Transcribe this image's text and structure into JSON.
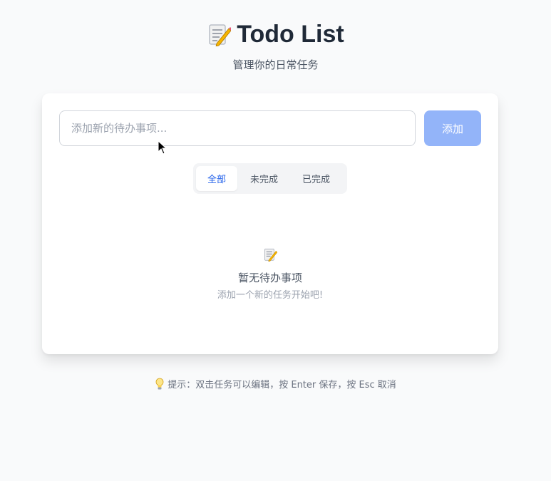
{
  "header": {
    "title": "Todo List",
    "title_icon": "memo-pencil-icon",
    "subtitle": "管理你的日常任务"
  },
  "composer": {
    "input_value": "",
    "input_placeholder": "添加新的待办事项...",
    "add_label": "添加"
  },
  "filters": {
    "tabs": [
      {
        "label": "全部",
        "active": true
      },
      {
        "label": "未完成",
        "active": false
      },
      {
        "label": "已完成",
        "active": false
      }
    ]
  },
  "empty_state": {
    "icon": "memo-pencil-icon",
    "title": "暂无待办事项",
    "subtitle": "添加一个新的任务开始吧!"
  },
  "hint": {
    "icon": "lightbulb-icon",
    "text": "提示：双击任务可以编辑，按 Enter 保存，按 Esc 取消"
  },
  "colors": {
    "accent": "#2563eb",
    "add_button_bg": "#93b4f9",
    "background": "#f9fafb"
  }
}
